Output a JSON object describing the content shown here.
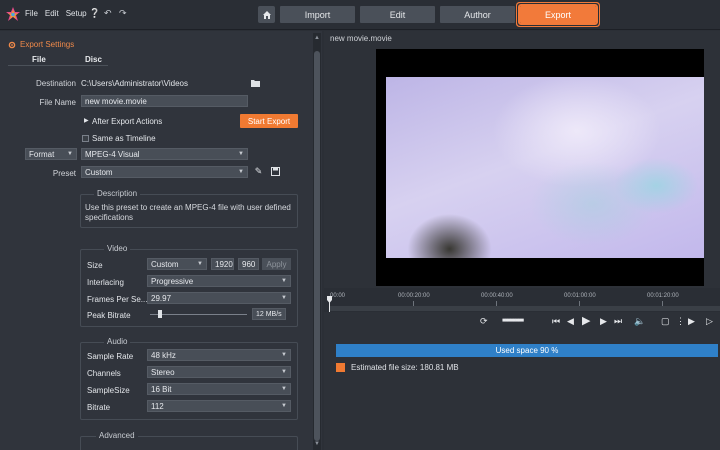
{
  "menu": [
    "File",
    "Edit",
    "Setup"
  ],
  "nav_tabs": [
    "Import",
    "Edit",
    "Author",
    "Export"
  ],
  "export_settings": {
    "title": "Export Settings",
    "subtabs": [
      "File",
      "Disc"
    ],
    "destination_label": "Destination",
    "destination_value": "C:\\Users\\Administrator\\Videos",
    "filename_label": "File Name",
    "filename_value": "new movie.movie",
    "after_export_label": "After Export Actions",
    "start_export_label": "Start Export",
    "same_as_timeline_label": "Same as Timeline",
    "format_label": "Format",
    "format_value": "MPEG-4 Visual",
    "preset_label": "Preset",
    "preset_value": "Custom",
    "description_title": "Description",
    "description_text": "Use this preset to create an MPEG-4 file with user defined specifications"
  },
  "video": {
    "title": "Video",
    "size_label": "Size",
    "size_value": "Custom",
    "width": "1920",
    "height": "960",
    "apply_label": "Apply",
    "interlacing_label": "Interlacing",
    "interlacing_value": "Progressive",
    "fps_label": "Frames Per Se...",
    "fps_value": "29.97",
    "bitrate_label": "Peak Bitrate",
    "bitrate_value": "12 MB/s",
    "bitrate_fraction": 0.08
  },
  "audio": {
    "title": "Audio",
    "sample_rate_label": "Sample Rate",
    "sample_rate_value": "48 kHz",
    "channels_label": "Channels",
    "channels_value": "Stereo",
    "sample_size_label": "SampleSize",
    "sample_size_value": "16 Bit",
    "bitrate_label": "Bitrate",
    "bitrate_value": "112"
  },
  "advanced_title": "Advanced",
  "preview": {
    "title": "new movie.movie",
    "timecodes": [
      "00:00",
      "00:00:20:00",
      "00:00:40:00",
      "00:01:00:00",
      "00:01:20:00"
    ]
  },
  "storage": {
    "used_space_label": "Used space 90 %",
    "used_fraction": 0.9,
    "estimated_size": "Estimated file size: 180.81 MB"
  },
  "colors": {
    "accent": "#f07a32",
    "space_bar": "#2f80c8",
    "background": "#2b2f36"
  }
}
